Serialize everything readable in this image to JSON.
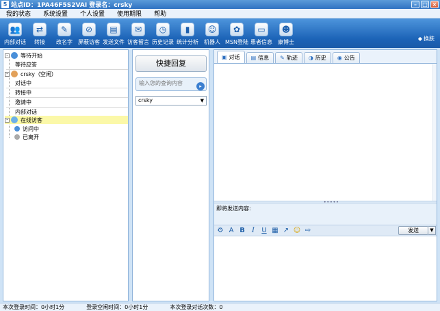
{
  "window": {
    "title": "站点ID：1PA46F5S2VAI 登录名：crsky",
    "app_icon": "5"
  },
  "menu": [
    "我的状态",
    "系统设置",
    "个人设置",
    "使用期限",
    "帮助"
  ],
  "toolbar": {
    "items": [
      {
        "label": "内部对话",
        "icon": "people-icon",
        "glyph": "👥"
      },
      {
        "label": "转接",
        "icon": "transfer-icon",
        "glyph": "⇄"
      },
      {
        "label": "改名字",
        "icon": "rename-icon",
        "glyph": "✎"
      },
      {
        "label": "屏蔽访客",
        "icon": "block-icon",
        "glyph": "⊘"
      },
      {
        "label": "发送文件",
        "icon": "file-icon",
        "glyph": "▤"
      },
      {
        "label": "访客留言",
        "icon": "message-icon",
        "glyph": "✉"
      },
      {
        "label": "历史记录",
        "icon": "history-icon",
        "glyph": "◷"
      },
      {
        "label": "统计分析",
        "icon": "stats-icon",
        "glyph": "▮"
      },
      {
        "label": "机器人",
        "icon": "robot-icon",
        "glyph": "☺"
      },
      {
        "label": "MSN登陆",
        "icon": "msn-icon",
        "glyph": "✿"
      },
      {
        "label": "患者信息",
        "icon": "book-icon",
        "glyph": "▭"
      },
      {
        "label": "康博士",
        "icon": "doctor-icon",
        "glyph": "☻"
      }
    ],
    "skin_label": "换肤"
  },
  "tree": {
    "waiting_root": "等待开始",
    "waiting_child": "等待应答",
    "user_root": "crsky（空闲）",
    "user_children": [
      "对话中",
      "转接中",
      "邀请中",
      "内部对话"
    ],
    "visitors_root": "在线访客",
    "visitors_children": [
      "访问中",
      "已离开"
    ]
  },
  "mid": {
    "quick_reply": "快捷回复",
    "search_placeholder": "输入您的查询内容",
    "select_value": "crsky"
  },
  "tabs": [
    {
      "label": "对话",
      "icon": "chat-icon",
      "glyph": "▣"
    },
    {
      "label": "信息",
      "icon": "info-icon",
      "glyph": "▤"
    },
    {
      "label": "轨迹",
      "icon": "track-icon",
      "glyph": "✎"
    },
    {
      "label": "历史",
      "icon": "history-icon",
      "glyph": "◑"
    },
    {
      "label": "公告",
      "icon": "notice-icon",
      "glyph": "◉"
    }
  ],
  "compose": {
    "pending_label": "即将发送内容:",
    "send_label": "发送"
  },
  "status": {
    "login_time": "本次登录时间：0小时1分",
    "idle_time": "登录空闲时间：0小时1分",
    "chat_count": "本次登录对话次数：0"
  }
}
